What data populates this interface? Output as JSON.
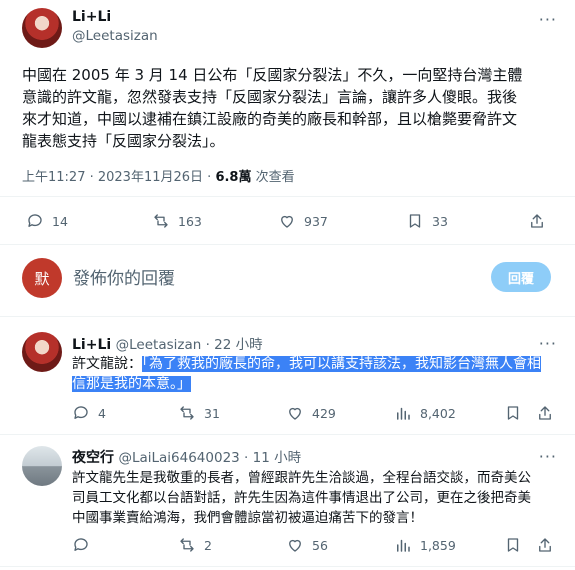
{
  "tweet": {
    "display_name": "Li+Li",
    "handle": "@Leetasizan",
    "body_lines": [
      "中國在 2005 年 3 月 14 日公布「反國家分裂法」不久，一向堅持台灣主體",
      "意識的許文龍，忽然發表支持「反國家分裂法」言論，讓許多人傻眼。我後",
      "來才知道，中國以逮補在鎮江設廠的奇美的廠長和幹部，且以槍斃要脅許文",
      "龍表態支持「反國家分裂法」。"
    ],
    "timestamp": "上午11:27 · 2023年11月26日 · ",
    "views_count": "6.8萬",
    "views_label": " 次查看",
    "stats": {
      "replies": "14",
      "reposts": "163",
      "likes": "937",
      "bookmarks": "33"
    }
  },
  "composer": {
    "avatar_char": "默",
    "placeholder": "發佈你的回覆",
    "button_label": "回覆"
  },
  "replies": [
    {
      "display_name": "Li+Li",
      "handle": "@Leetasizan",
      "time": " · 22 小時",
      "body_prefix": "許文龍說：",
      "body_highlight_1": "「為了救我的廠長的命，我可以講支持該法，我知影台灣無人會相",
      "body_highlight_2": "信那是我的本意。」",
      "stats": {
        "replies": "4",
        "reposts": "31",
        "likes": "429",
        "views": "8,402"
      }
    },
    {
      "display_name": "夜空行",
      "handle": "@LaiLai64640023",
      "time": " · 11 小時",
      "body_lines": [
        "許文龍先生是我敬重的長者，曾經跟許先生洽談過，全程台語交談，而奇美公",
        "司員工文化都以台語對話，許先生因為這件事情退出了公司，更在之後把奇美",
        "中國事業賣給鴻海，我們會體諒當初被逼迫痛苦下的發言！"
      ],
      "stats": {
        "replies": "",
        "reposts": "2",
        "likes": "56",
        "views": "1,859"
      }
    }
  ],
  "colors": {
    "accent": "#1d9bf0",
    "muted": "#536471",
    "highlight": "#3b82f6",
    "reply_button": "#8ecdf8"
  },
  "icons": [
    "more-icon",
    "reply-icon",
    "repost-icon",
    "like-icon",
    "bookmark-icon",
    "share-icon",
    "views-icon"
  ]
}
